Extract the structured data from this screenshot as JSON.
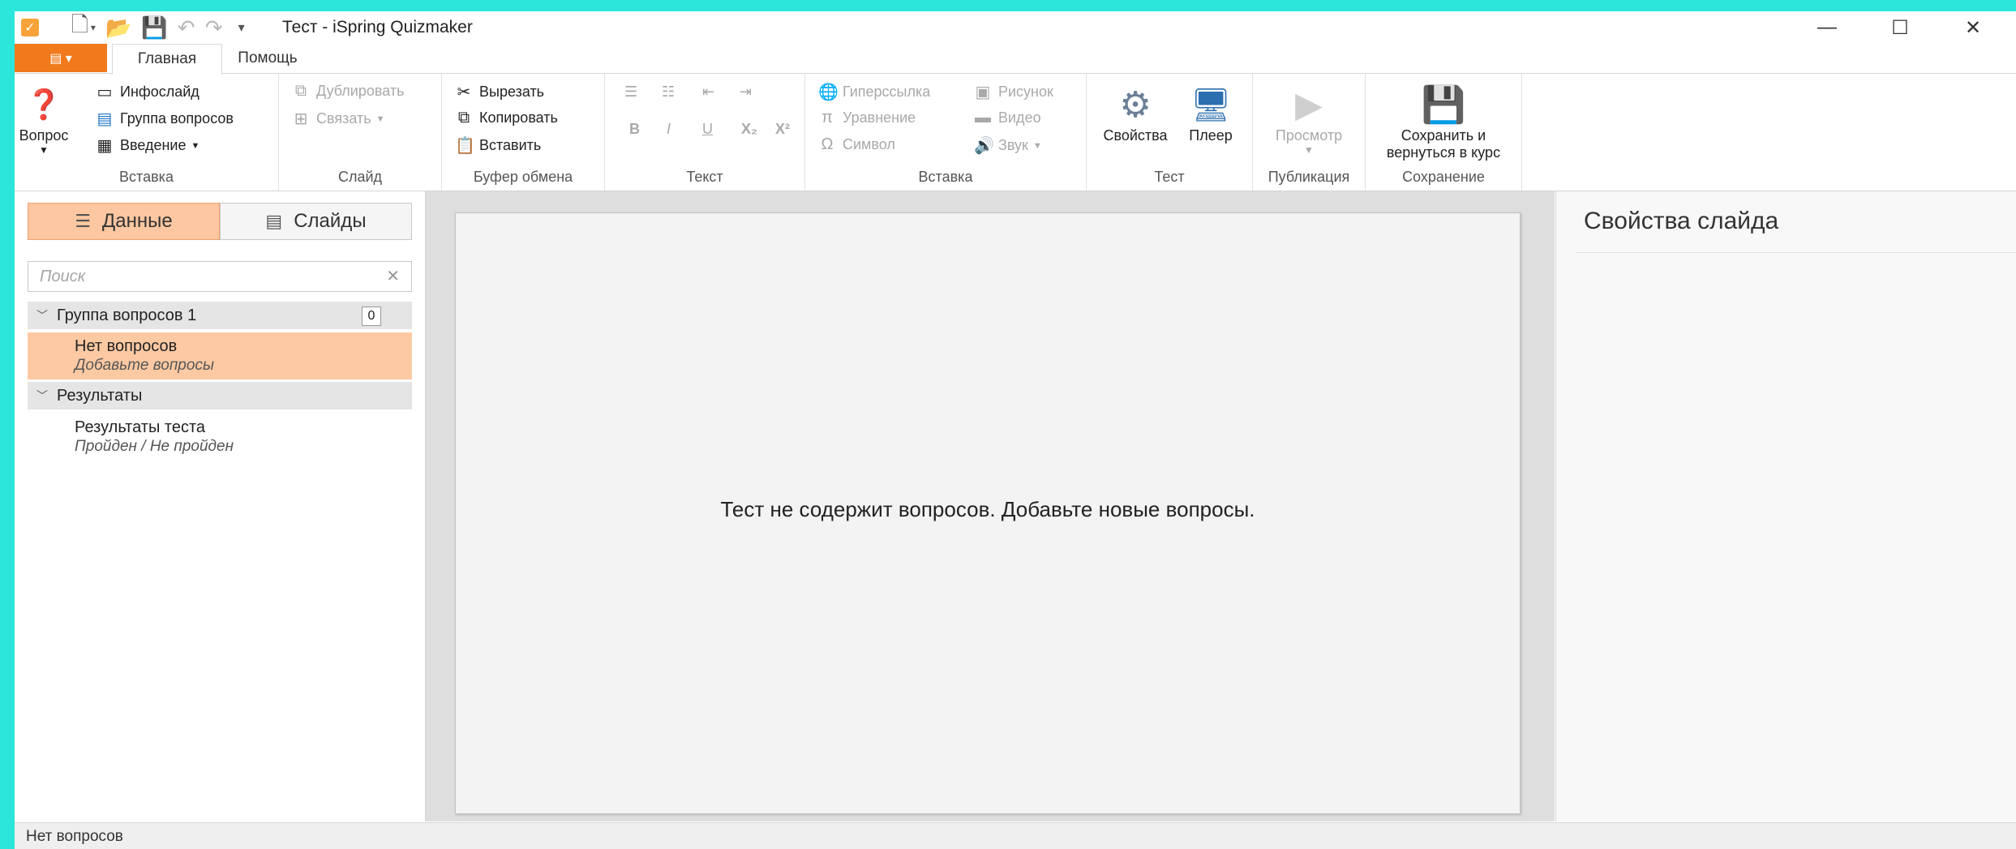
{
  "window": {
    "title": "Тест - iSpring Quizmaker"
  },
  "tabs": [
    "Главная",
    "Помощь"
  ],
  "ribbon": {
    "insert": {
      "label": "Вставка",
      "question": "Вопрос",
      "infoslide": "Инфослайд",
      "question_group": "Группа вопросов",
      "intro": "Введение"
    },
    "slide": {
      "label": "Слайд",
      "duplicate": "Дублировать",
      "link": "Связать"
    },
    "clipboard": {
      "label": "Буфер обмена",
      "cut": "Вырезать",
      "copy": "Копировать",
      "paste": "Вставить"
    },
    "text": {
      "label": "Текст",
      "bold": "B",
      "italic": "I",
      "underline": "U",
      "subscript": "X₂",
      "superscript": "X²"
    },
    "insert2": {
      "label": "Вставка",
      "hyperlink": "Гиперссылка",
      "equation": "Уравнение",
      "symbol": "Символ",
      "picture": "Рисунок",
      "video": "Видео",
      "sound": "Звук"
    },
    "test": {
      "label": "Тест",
      "properties": "Свойства",
      "player": "Плеер"
    },
    "publish": {
      "label": "Публикация",
      "preview": "Просмотр"
    },
    "save": {
      "label": "Сохранение",
      "save_return_l1": "Сохранить и",
      "save_return_l2": "вернуться в курс"
    }
  },
  "left": {
    "view_data": "Данные",
    "view_slides": "Слайды",
    "search_placeholder": "Поиск",
    "group1": {
      "title": "Группа вопросов 1",
      "count": "0"
    },
    "item1": {
      "title": "Нет вопросов",
      "subtitle": "Добавьте вопросы"
    },
    "group2": {
      "title": "Результаты"
    },
    "item2": {
      "title": "Результаты теста",
      "subtitle": "Пройден / Не пройден"
    }
  },
  "center": {
    "message": "Тест не содержит вопросов. Добавьте новые вопросы."
  },
  "right": {
    "title": "Свойства слайда"
  },
  "status": {
    "text": "Нет вопросов"
  },
  "colors": {
    "accent": "#f07a1c",
    "selection": "#fdc9a3",
    "background": "#2ce6dc"
  }
}
